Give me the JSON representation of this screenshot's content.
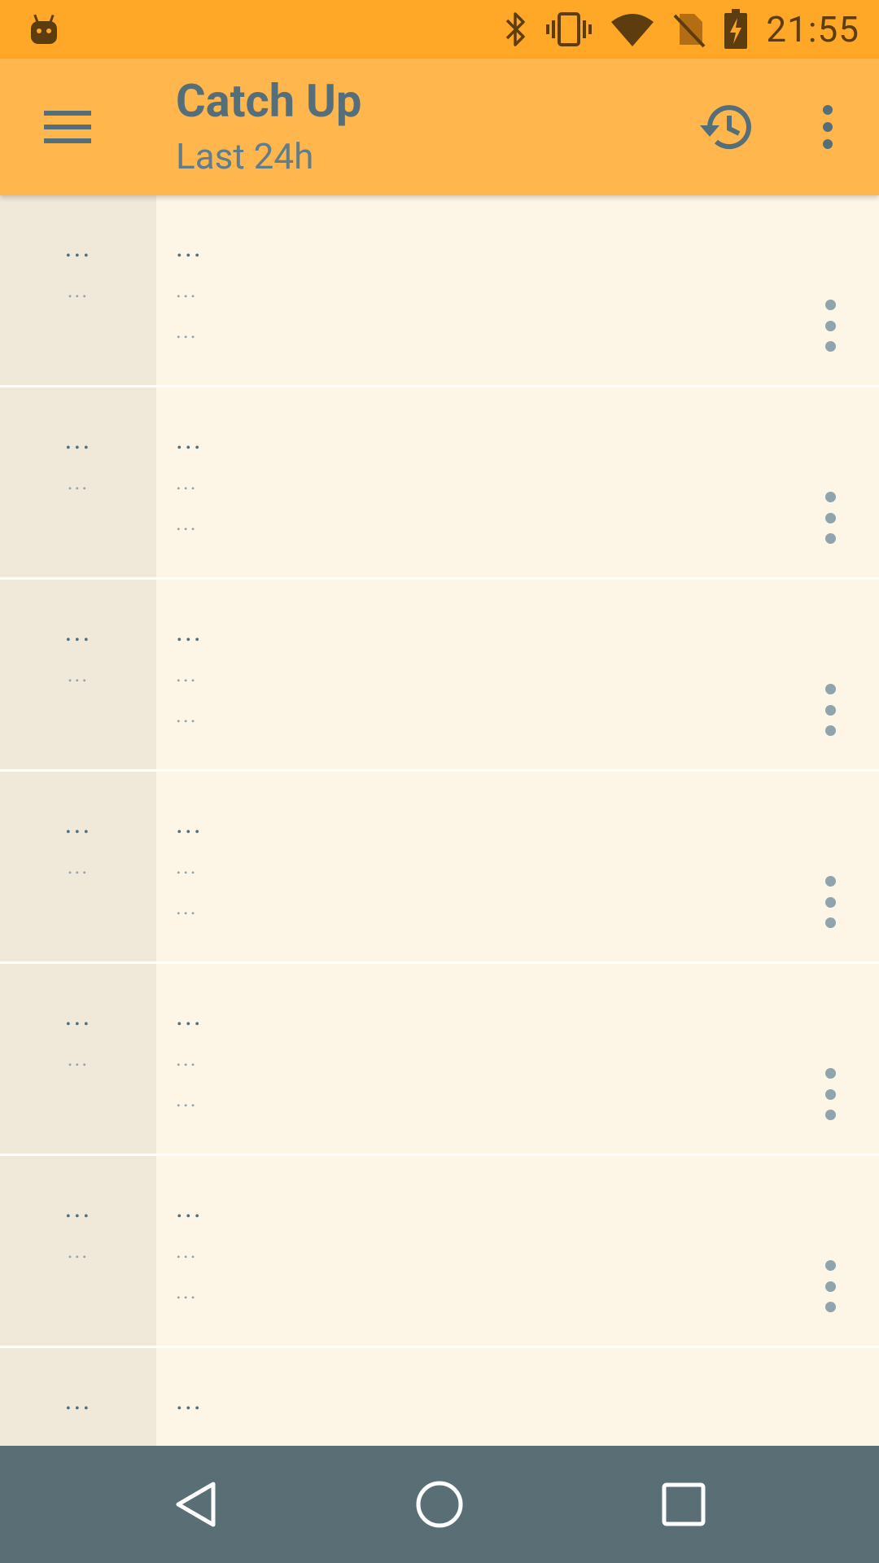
{
  "status_bar": {
    "time": "21:55",
    "icons": [
      "android-notification-icon",
      "bluetooth-icon",
      "vibrate-icon",
      "wifi-icon",
      "no-sim-icon",
      "battery-charging-icon"
    ]
  },
  "app_bar": {
    "title": "Catch Up",
    "subtitle": "Last 24h",
    "actions": [
      "history-icon",
      "more-vert-icon"
    ]
  },
  "list": {
    "items": [
      {
        "score": "...",
        "comments": "...",
        "title": "...",
        "meta1": "...",
        "meta2": "..."
      },
      {
        "score": "...",
        "comments": "...",
        "title": "...",
        "meta1": "...",
        "meta2": "..."
      },
      {
        "score": "...",
        "comments": "...",
        "title": "...",
        "meta1": "...",
        "meta2": "..."
      },
      {
        "score": "...",
        "comments": "...",
        "title": "...",
        "meta1": "...",
        "meta2": "..."
      },
      {
        "score": "...",
        "comments": "...",
        "title": "...",
        "meta1": "...",
        "meta2": "..."
      },
      {
        "score": "...",
        "comments": "...",
        "title": "...",
        "meta1": "...",
        "meta2": "..."
      },
      {
        "score": "...",
        "comments": "",
        "title": "...",
        "meta1": "",
        "meta2": ""
      }
    ]
  },
  "nav_bar": {
    "buttons": [
      "back-icon",
      "home-icon",
      "recents-icon"
    ]
  },
  "colors": {
    "status_bar": "#ffa726",
    "app_bar": "#ffb74d",
    "list_bg": "#fdf5e5",
    "row_left_bg": "#f0e8d8",
    "nav_bar": "#5a6e75",
    "title_text": "#546e7a"
  }
}
